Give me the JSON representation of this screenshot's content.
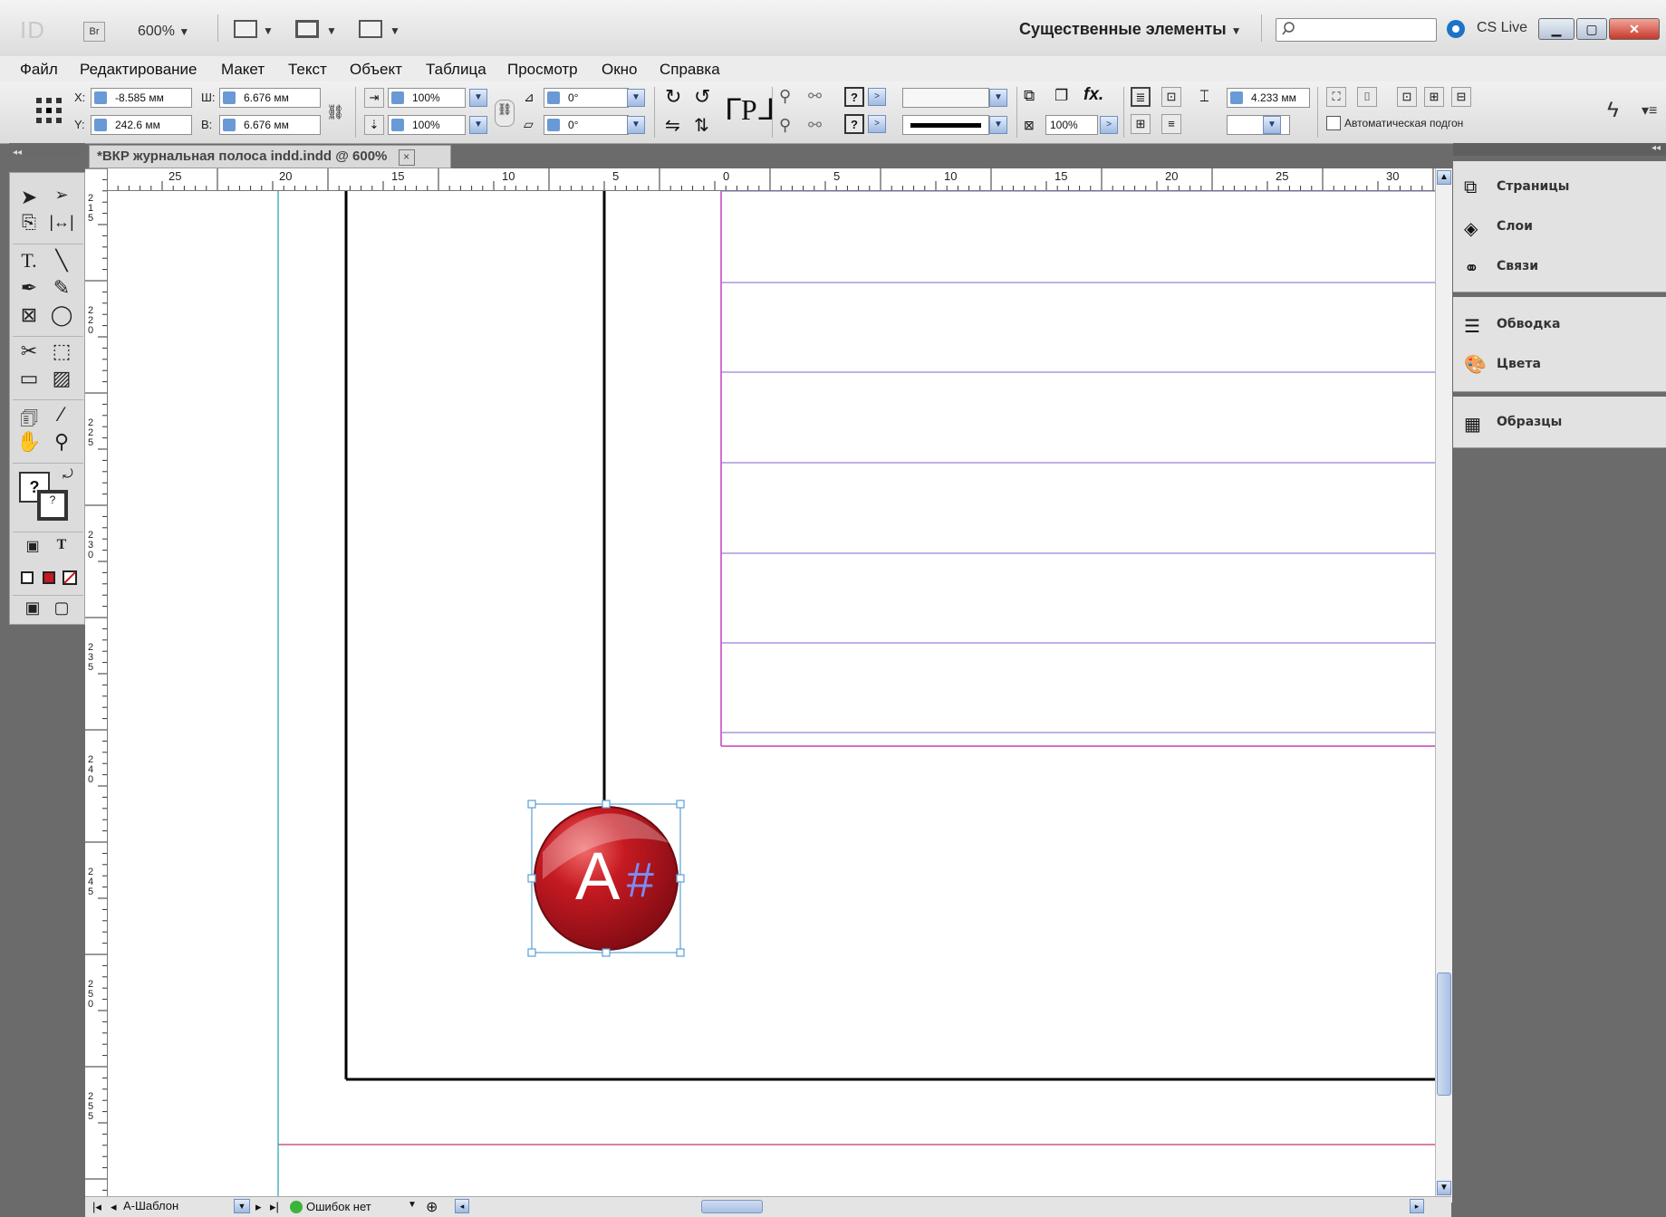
{
  "appbar": {
    "logo": "ID",
    "bridge": "Br",
    "zoom": "600%",
    "workspace": "Существенные элементы",
    "cslive": "CS Live"
  },
  "menu": [
    "Файл",
    "Редактирование",
    "Макет",
    "Текст",
    "Объект",
    "Таблица",
    "Просмотр",
    "Окно",
    "Справка"
  ],
  "control": {
    "x_label": "X:",
    "x_value": "-8.585 мм",
    "y_label": "Y:",
    "y_value": "242.6 мм",
    "w_label": "Ш:",
    "w_value": "6.676 мм",
    "h_label": "В:",
    "h_value": "6.676 мм",
    "scale_x": "100%",
    "scale_y": "100%",
    "rotate": "0°",
    "shear": "0°",
    "stroke_weight": "4.233 мм",
    "opacity": "100%",
    "auto_fit": "Автоматическая подгон"
  },
  "document": {
    "tab_title": "*ВКР журнальная полоса indd.indd @ 600%",
    "close": "×",
    "h_ruler": [
      "25",
      "20",
      "15",
      "10",
      "5",
      "0",
      "5",
      "10",
      "15",
      "20",
      "25",
      "30"
    ],
    "v_ruler": [
      "2\n1\n5",
      "2\n2\n0",
      "2\n2\n5",
      "2\n3\n0",
      "2\n3\n5",
      "2\n4\n0",
      "2\n4\n5",
      "2\n5\n0",
      "2\n5\n5"
    ],
    "logo_text": "A",
    "logo_sup": "#"
  },
  "status": {
    "page": "А-Шаблон",
    "errors": "Ошибок нет"
  },
  "panels": {
    "group1": [
      "Страницы",
      "Слои",
      "Связи"
    ],
    "group2": [
      "Обводка",
      "Цвета"
    ],
    "group3": [
      "Образцы"
    ]
  },
  "colors": {
    "accent": "#c61a22",
    "guide": "#9a7fd6",
    "margin": "#c63ec0",
    "bleed": "#c85b7a",
    "column": "#47b7c3"
  }
}
